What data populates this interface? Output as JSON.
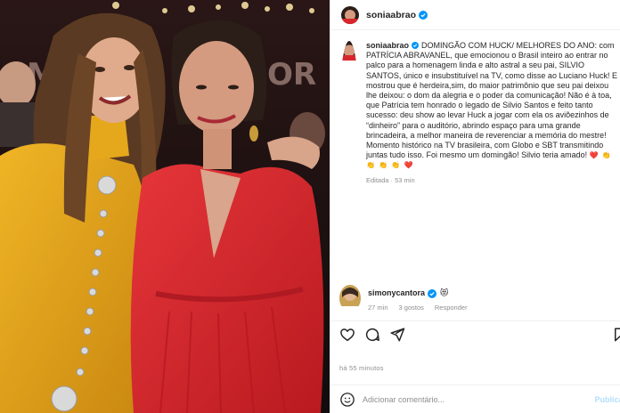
{
  "post": {
    "username": "soniaabrao",
    "caption": {
      "username": "soniaabrao",
      "text": "DOMINGÃO COM HUCK/ MELHORES DO ANO: com PATRÍCIA ABRAVANEL, que emocionou o Brasil inteiro ao entrar no palco para a homenagem linda e alto astral a seu pai, SILVIO SANTOS, único e insubstituível na TV, como disse ao Luciano Huck! E mostrou que é herdeira,sim, do maior patrimônio que seu pai deixou lhe deixou: o dom da alegria e o poder da comunicação! Não é à toa, que Patrícia tem honrado o legado de Silvio Santos e feito tanto sucesso: deu show ao levar Huck a jogar com ela os aviõezinhos de “dinheiro” para o auditório, abrindo espaço para uma grande brincadeira, a melhor maneira de reverenciar a memória do mestre! Momento histórico na TV brasileira, com Globo e SBT transmitindo juntas tudo isso. Foi mesmo um domingão! Silvio teria amado!",
      "emojis": "❤️ 👏 👏 👏 👏 ❤️",
      "edited_label": "Editada",
      "time": "53 min"
    },
    "comment": {
      "username": "simonycantora",
      "emoji": "😻",
      "time": "27 min",
      "likes": "3 gostos",
      "reply": "Responder"
    },
    "posted_ago": "há 55 minutos",
    "add_comment": {
      "placeholder": "Adicionar comentário...",
      "publish": "Publicar"
    }
  },
  "colors": {
    "verified": "#0095f6",
    "dress_yellow": "#e0a01a",
    "dress_red": "#d8272c",
    "stage_background": "#1a1212",
    "muted_text": "#8e8e8e"
  },
  "icons": [
    "heart-icon",
    "comment-icon",
    "share-icon",
    "bookmark-icon",
    "emoji-icon",
    "verified-badge-icon"
  ]
}
